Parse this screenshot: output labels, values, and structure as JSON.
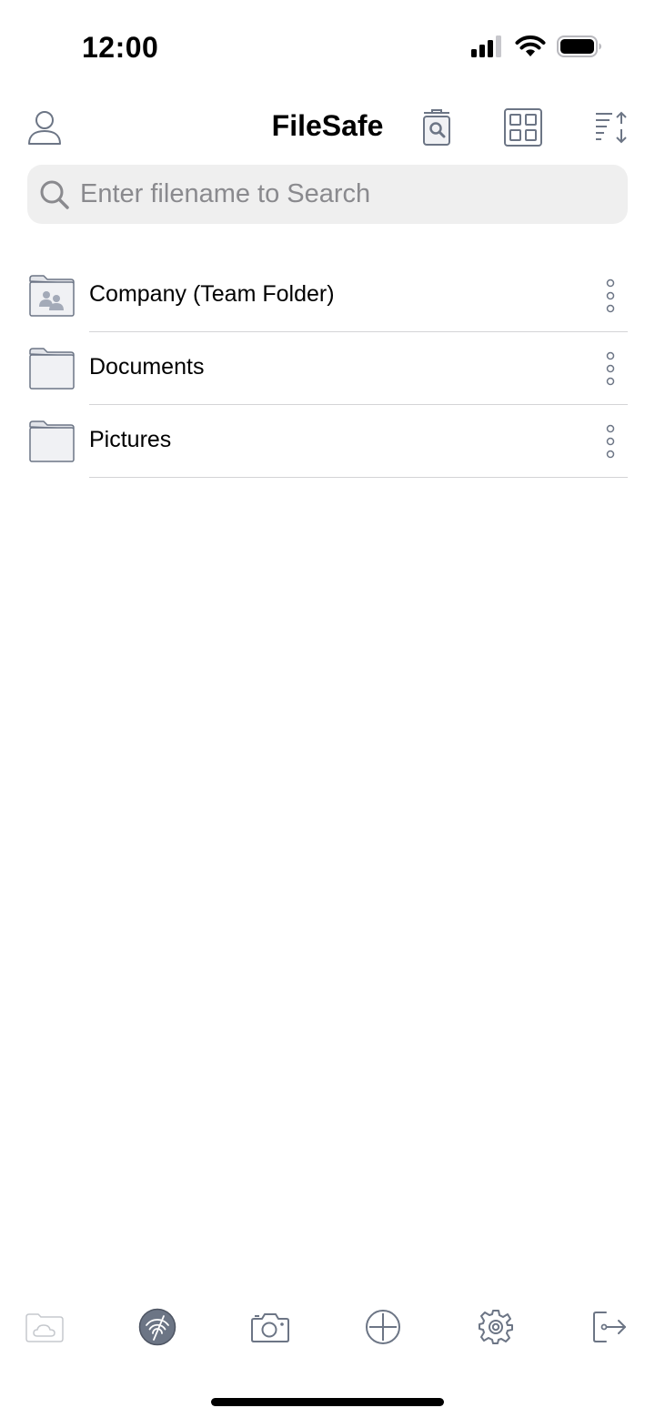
{
  "status_bar": {
    "time": "12:00"
  },
  "header": {
    "title": "FileSafe"
  },
  "search": {
    "placeholder": "Enter filename to Search",
    "value": ""
  },
  "files": [
    {
      "name": "Company (Team Folder)",
      "icon": "team-folder-icon"
    },
    {
      "name": "Documents",
      "icon": "folder-icon"
    },
    {
      "name": "Pictures",
      "icon": "folder-icon"
    }
  ],
  "colors": {
    "icon_gray": "#6c7585",
    "folder_fill": "#f0f1f4",
    "search_bg": "#efefef",
    "placeholder": "#8a8a8e",
    "disabled_icon": "#c5c8cd"
  },
  "tab_bar": {
    "items": [
      {
        "icon": "cloud-folder-icon",
        "state": "disabled"
      },
      {
        "icon": "wifi-transfer-icon",
        "state": "active"
      },
      {
        "icon": "camera-icon",
        "state": "normal"
      },
      {
        "icon": "add-circle-icon",
        "state": "normal"
      },
      {
        "icon": "settings-gear-icon",
        "state": "normal"
      },
      {
        "icon": "logout-icon",
        "state": "normal"
      }
    ]
  }
}
